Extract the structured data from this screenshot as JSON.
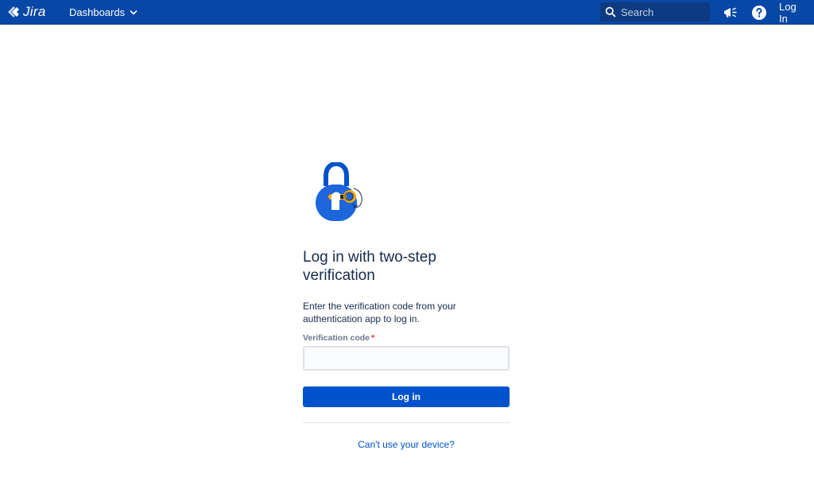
{
  "header": {
    "logo_text": "Jira",
    "dashboards_label": "Dashboards",
    "search_placeholder": "Search",
    "login_label": "Log In"
  },
  "icons": {
    "logo": "jira-logo-icon",
    "dropdown": "chevron-down-icon",
    "search": "search-icon",
    "announcement": "megaphone-icon",
    "help": "help-icon",
    "illustration": "padlock-key-icon"
  },
  "main": {
    "title": "Log in with two-step verification",
    "description": "Enter the verification code from your authentication app to log in.",
    "field_label": "Verification code",
    "required_marker": "*",
    "code_value": "",
    "submit_label": "Log in",
    "alt_link": "Can't use your device?"
  },
  "colors": {
    "header_bg": "#0747a6",
    "primary": "#0052cc",
    "text": "#172b4d",
    "required": "#de350b"
  }
}
